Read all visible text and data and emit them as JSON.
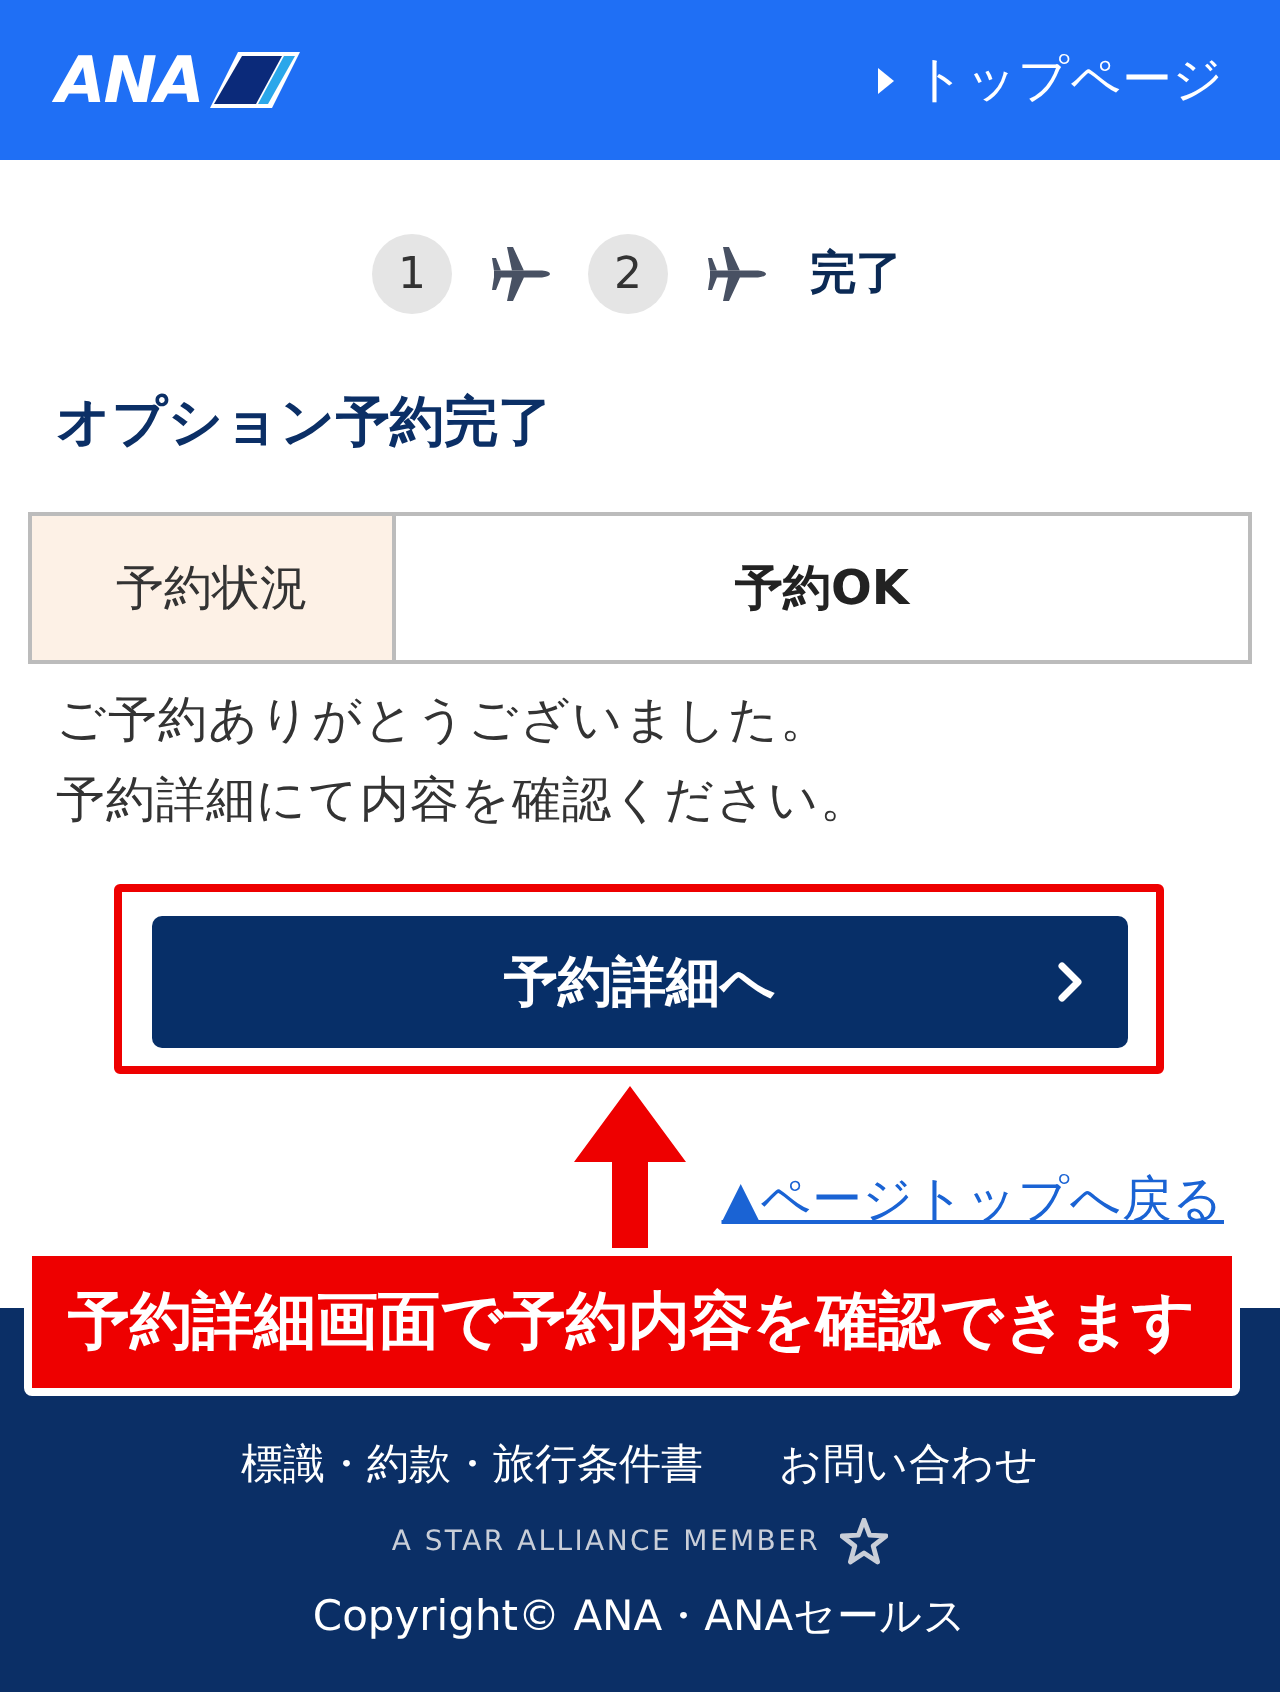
{
  "header": {
    "logo": "ANA",
    "top_link": "トップページ"
  },
  "steps": [
    {
      "label": "1",
      "selected": false
    },
    {
      "label": "2",
      "selected": false
    },
    {
      "label": "完了",
      "selected": true
    }
  ],
  "heading": "オプション予約完了",
  "status_table": {
    "label": "予約状況",
    "value": "予約OK"
  },
  "message": [
    "ご予約ありがとうございました。",
    "予約詳細にて内容を確認ください。"
  ],
  "detail_button": {
    "label": "予約詳細へ"
  },
  "page_top_link": "▲ページトップへ戻る",
  "footer": {
    "links": [
      "標識・約款・旅行条件書",
      "お問い合わせ"
    ],
    "alliance": "A STAR ALLIANCE MEMBER",
    "copyright": "Copyright© ANA・ANAセールス"
  },
  "annotation": {
    "text": "予約詳細画面で予約内容を確認できます"
  }
}
